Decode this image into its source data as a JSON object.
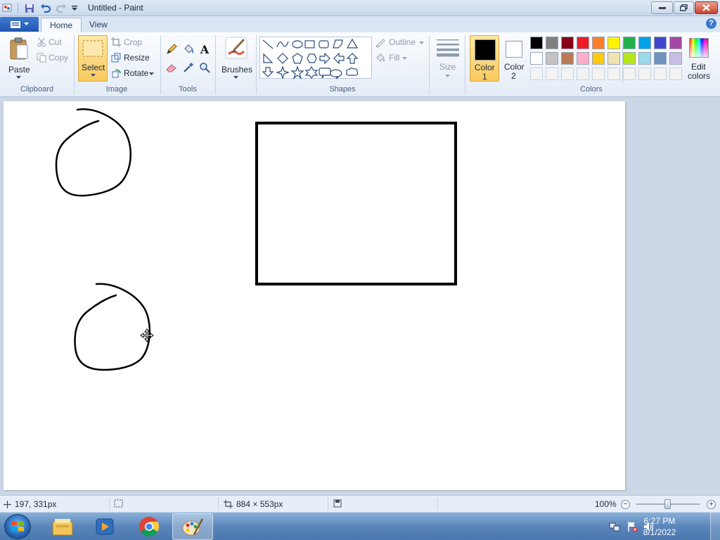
{
  "window": {
    "title": "Untitled - Paint"
  },
  "tabs": [
    {
      "label": "Home"
    },
    {
      "label": "View"
    }
  ],
  "ribbon": {
    "clipboard": {
      "group_label": "Clipboard",
      "paste": "Paste",
      "cut": "Cut",
      "copy": "Copy"
    },
    "image": {
      "group_label": "Image",
      "select": "Select",
      "crop": "Crop",
      "resize": "Resize",
      "rotate": "Rotate"
    },
    "tools": {
      "group_label": "Tools",
      "items": [
        "pencil-icon",
        "fill-bucket-icon",
        "text-icon",
        "eraser-icon",
        "color-picker-icon",
        "magnifier-icon"
      ]
    },
    "brushes": {
      "label": "Brushes"
    },
    "shapes": {
      "group_label": "Shapes",
      "outline": "Outline",
      "fill": "Fill",
      "items": [
        "line",
        "curve",
        "oval",
        "rectangle",
        "rounded-rectangle",
        "polygon",
        "triangle",
        "right-triangle",
        "diamond",
        "pentagon",
        "hexagon",
        "right-arrow",
        "left-arrow",
        "up-arrow",
        "down-arrow",
        "four-point-star",
        "five-point-star",
        "six-point-star",
        "rounded-callout",
        "oval-callout",
        "cloud-callout"
      ]
    },
    "size": {
      "label": "Size"
    },
    "colors": {
      "group_label": "Colors",
      "color1_label_line1": "Color",
      "color1_label_line2": "1",
      "color2_label_line1": "Color",
      "color2_label_line2": "2",
      "color1": "#000000",
      "color2": "#ffffff",
      "edit_label_line1": "Edit",
      "edit_label_line2": "colors",
      "palette_row1": [
        "#000000",
        "#7f7f7f",
        "#880015",
        "#ed1c24",
        "#ff7f27",
        "#fff200",
        "#22b14c",
        "#00a2e8",
        "#3f48cc",
        "#a349a4"
      ],
      "palette_row2": [
        "#ffffff",
        "#c3c3c3",
        "#b97a57",
        "#ffaec9",
        "#ffc90e",
        "#efe4b0",
        "#b5e61d",
        "#99d9ea",
        "#7092be",
        "#c8bfe7"
      ],
      "palette_row3": [
        "#f3f3f3",
        "#f3f3f3",
        "#f3f3f3",
        "#f3f3f3",
        "#f3f3f3",
        "#f3f3f3",
        "#f3f3f3",
        "#f3f3f3",
        "#f3f3f3",
        "#f3f3f3"
      ]
    }
  },
  "statusbar": {
    "cursor_position": "197, 331px",
    "canvas_size": "884 × 553px",
    "zoom": "100%"
  },
  "taskbar": {
    "items": [
      "file-explorer-icon",
      "media-player-icon",
      "chrome-icon",
      "paint-icon"
    ],
    "time": "6:27 PM",
    "date": "8/1/2022"
  }
}
